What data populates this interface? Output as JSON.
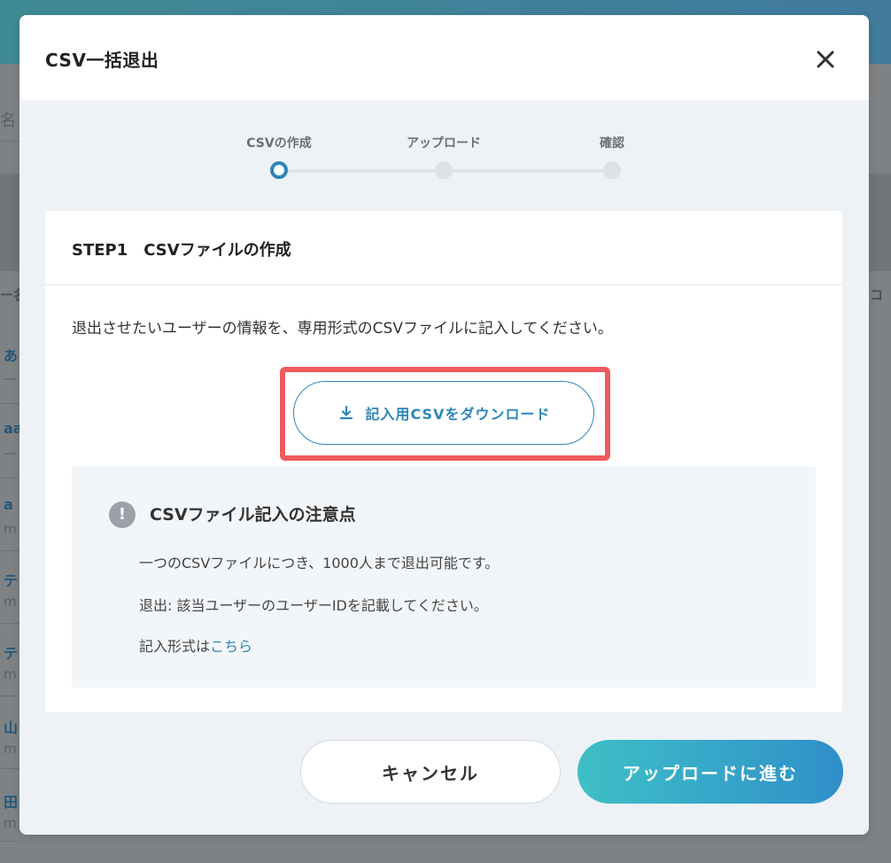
{
  "background": {
    "search_partial": "名 /",
    "col_left": "ー名",
    "col_right": "コ",
    "rows": [
      {
        "primary": "あ",
        "secondary": "—"
      },
      {
        "primary": "aa",
        "secondary": "—"
      },
      {
        "primary": "a",
        "secondary": "m"
      },
      {
        "primary": "テ",
        "secondary": "m"
      },
      {
        "primary": "テ",
        "secondary": "m"
      },
      {
        "primary": "山",
        "secondary": "m"
      },
      {
        "primary": "田",
        "secondary": "m"
      }
    ]
  },
  "modal": {
    "title": "CSV一括退出",
    "close_icon": "close-icon"
  },
  "stepper": {
    "steps": [
      {
        "label": "CSVの作成",
        "active": true
      },
      {
        "label": "アップロード",
        "active": false
      },
      {
        "label": "確認",
        "active": false
      }
    ]
  },
  "step_card": {
    "title": "STEP1　CSVファイルの作成",
    "description": "退出させたいユーザーの情報を、専用形式のCSVファイルに記入してください。",
    "download_button": {
      "label": "記入用CSVをダウンロード",
      "icon": "download-icon"
    },
    "highlight_color": "#f05a5e"
  },
  "notes": {
    "icon": "exclamation-icon",
    "title": "CSVファイル記入の注意点",
    "lines": [
      "一つのCSVファイルにつき、1000人まで退出可能です。",
      "退出: 該当ユーザーのユーザーIDを記載してください。"
    ],
    "format_prefix": "記入形式は",
    "format_link": "こちら"
  },
  "footer": {
    "cancel_label": "キャンセル",
    "next_label": "アップロードに進む"
  },
  "colors": {
    "accent": "#2e86b8",
    "gradient_start": "#3ec0c7",
    "gradient_end": "#2f8fc9"
  }
}
